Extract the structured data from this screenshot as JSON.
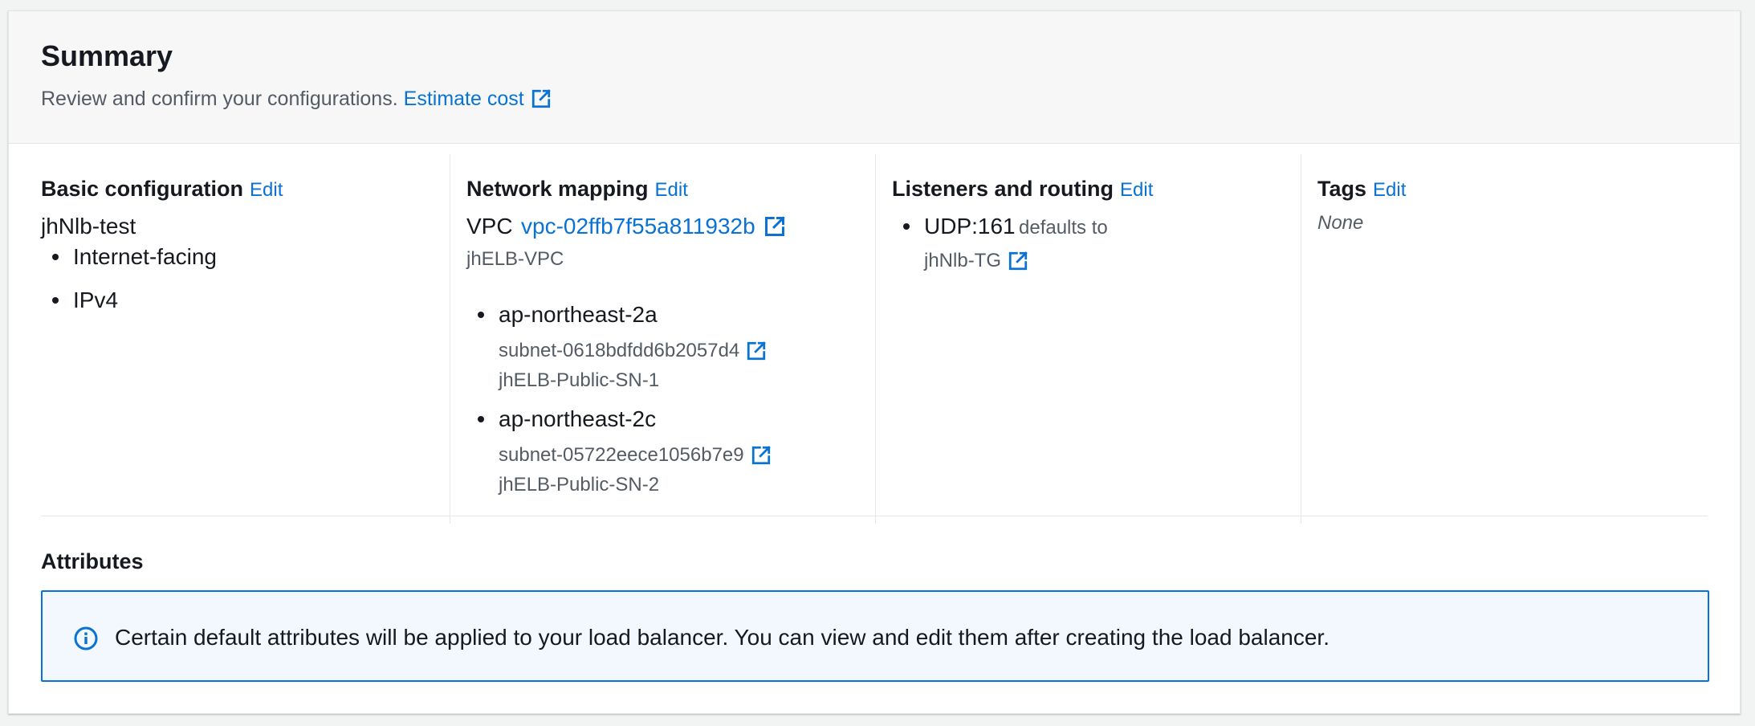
{
  "summary": {
    "title": "Summary",
    "subtitle": "Review and confirm your configurations.",
    "estimate_cost_label": "Estimate cost"
  },
  "basic_configuration": {
    "title": "Basic configuration",
    "edit_label": "Edit",
    "name": "jhNlb-test",
    "items": [
      "Internet-facing",
      "IPv4"
    ]
  },
  "network_mapping": {
    "title": "Network mapping",
    "edit_label": "Edit",
    "vpc_label": "VPC",
    "vpc_id": "vpc-02ffb7f55a811932b",
    "vpc_name": "jhELB-VPC",
    "zones": [
      {
        "zone": "ap-northeast-2a",
        "subnet_id": "subnet-0618bdfdd6b2057d4",
        "subnet_name": "jhELB-Public-SN-1"
      },
      {
        "zone": "ap-northeast-2c",
        "subnet_id": "subnet-05722eece1056b7e9",
        "subnet_name": "jhELB-Public-SN-2"
      }
    ]
  },
  "listeners_routing": {
    "title": "Listeners and routing",
    "edit_label": "Edit",
    "listener": "UDP:161",
    "defaults_to": "defaults to",
    "target_group": "jhNlb-TG"
  },
  "tags": {
    "title": "Tags",
    "edit_label": "Edit",
    "value": "None"
  },
  "attributes": {
    "title": "Attributes",
    "info_text": "Certain default attributes will be applied to your load balancer. You can view and edit them after creating the load balancer."
  },
  "colors": {
    "link": "#0972d3",
    "alert_bg": "#f2f8fd",
    "text": "#16191f",
    "secondary_text": "#545b64"
  },
  "icons": [
    "external-link-icon",
    "info-icon"
  ]
}
